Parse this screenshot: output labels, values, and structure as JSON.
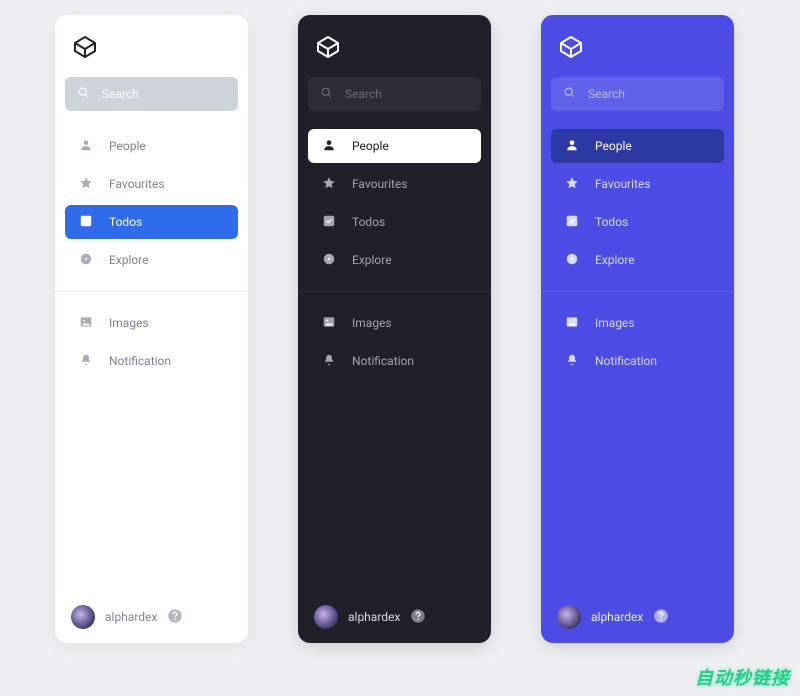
{
  "search": {
    "placeholder": "Search"
  },
  "nav_section1": [
    {
      "id": "people",
      "label": "People",
      "icon": "person"
    },
    {
      "id": "favourites",
      "label": "Favourites",
      "icon": "star"
    },
    {
      "id": "todos",
      "label": "Todos",
      "icon": "checkbox"
    },
    {
      "id": "explore",
      "label": "Explore",
      "icon": "compass"
    }
  ],
  "nav_section2": [
    {
      "id": "images",
      "label": "Images",
      "icon": "image"
    },
    {
      "id": "notification",
      "label": "Notification",
      "icon": "bell"
    }
  ],
  "active": {
    "light": "todos",
    "dark": "people",
    "blue": "people"
  },
  "user": {
    "name": "alphardex"
  },
  "watermark": "自动秒链接",
  "colors": {
    "light_bg": "#ffffff",
    "dark_bg": "#1f2029",
    "blue_bg": "#4b4de4",
    "light_active": "#2e6cec",
    "blue_active": "#2e3aa3"
  }
}
